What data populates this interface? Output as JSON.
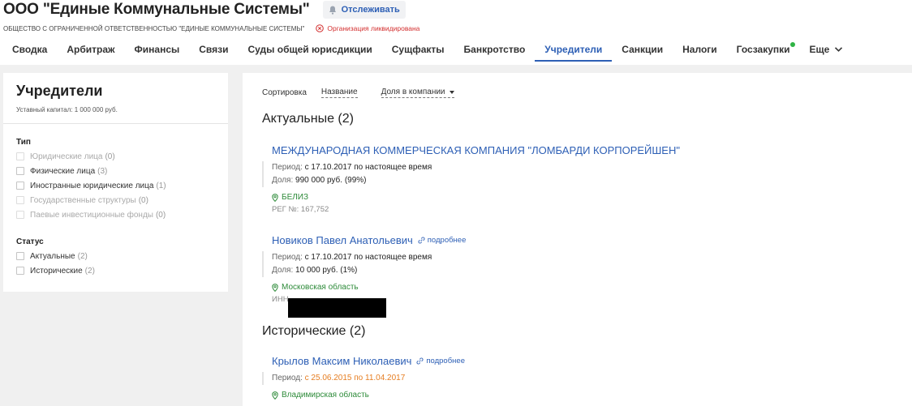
{
  "header": {
    "company_title": "ООО \"Единые Коммунальные Системы\"",
    "track_label": "Отслеживать",
    "full_name": "ОБЩЕСТВО С ОГРАНИЧЕННОЙ ОТВЕТСТВЕННОСТЬЮ \"ЕДИНЫЕ КОММУНАЛЬНЫЕ СИСТЕМЫ\"",
    "liquidated_label": "Организация ликвидирована"
  },
  "tabs": [
    {
      "label": "Сводка"
    },
    {
      "label": "Арбитраж"
    },
    {
      "label": "Финансы"
    },
    {
      "label": "Связи"
    },
    {
      "label": "Суды общей юрисдикции"
    },
    {
      "label": "Сущфакты"
    },
    {
      "label": "Банкротство"
    },
    {
      "label": "Учредители"
    },
    {
      "label": "Санкции"
    },
    {
      "label": "Налоги"
    },
    {
      "label": "Госзакупки"
    },
    {
      "label": "Еще"
    }
  ],
  "sidebar": {
    "title": "Учредители",
    "capital": "Уставный капитал: 1 000 000 руб.",
    "type_title": "Тип",
    "type_items": [
      {
        "label": "Юридические лица",
        "count": "(0)"
      },
      {
        "label": "Физические лица",
        "count": "(3)"
      },
      {
        "label": "Иностранные юридические лица",
        "count": "(1)"
      },
      {
        "label": "Государственные структуры",
        "count": "(0)"
      },
      {
        "label": "Паевые инвестиционные фонды",
        "count": "(0)"
      }
    ],
    "status_title": "Статус",
    "status_items": [
      {
        "label": "Актуальные",
        "count": "(2)"
      },
      {
        "label": "Исторические",
        "count": "(2)"
      }
    ]
  },
  "main": {
    "sort_label": "Сортировка",
    "sort_name": "Название",
    "sort_share": "Доля в компании",
    "actual_heading": "Актуальные (2)",
    "historical_heading": "Исторические (2)",
    "more_label": "подробнее",
    "period_label": "Период:",
    "share_label": "Доля:",
    "entities": [
      {
        "name": "МЕЖДУНАРОДНАЯ КОММЕРЧЕСКАЯ КОМПАНИЯ \"ЛОМБАРДИ КОРПОРЕЙШЕН\"",
        "period": "с 17.10.2017 по настоящее время",
        "share": "990 000 руб. (99%)",
        "location": "БЕЛИЗ",
        "extra": "РЕГ №: 167,752"
      },
      {
        "name": "Новиков Павел Анатольевич",
        "period": "с 17.10.2017 по настоящее время",
        "share": "10 000 руб. (1%)",
        "location": "Московская область",
        "extra": "ИНН"
      },
      {
        "name": "Крылов Максим Николаевич",
        "period": "с 25.06.2015 по 11.04.2017",
        "location": "Владимирская область"
      }
    ]
  },
  "colors": {
    "accent": "#2d5fb5",
    "danger": "#d32f2f",
    "location": "#2e8b3a",
    "historical_period": "#e67e22",
    "notification_dot": "#2fb344"
  }
}
